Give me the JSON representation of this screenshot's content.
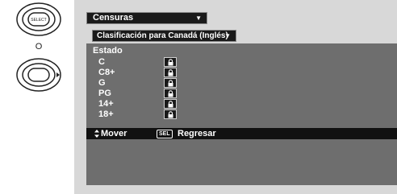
{
  "remote": {
    "or_label": "O",
    "select_button_text": "SELECT"
  },
  "menu": {
    "censuras_label": "Censuras",
    "clasificacion_label": "Clasificación para Canadá (Inglés)",
    "estado_label": "Estado",
    "ratings": [
      {
        "label": "C",
        "locked": true
      },
      {
        "label": "C8+",
        "locked": true
      },
      {
        "label": "G",
        "locked": true
      },
      {
        "label": "PG",
        "locked": true
      },
      {
        "label": "14+",
        "locked": true
      },
      {
        "label": "18+",
        "locked": true
      }
    ]
  },
  "nav": {
    "mover_label": "Mover",
    "sel_badge": "SEL",
    "regresar_label": "Regresar"
  }
}
